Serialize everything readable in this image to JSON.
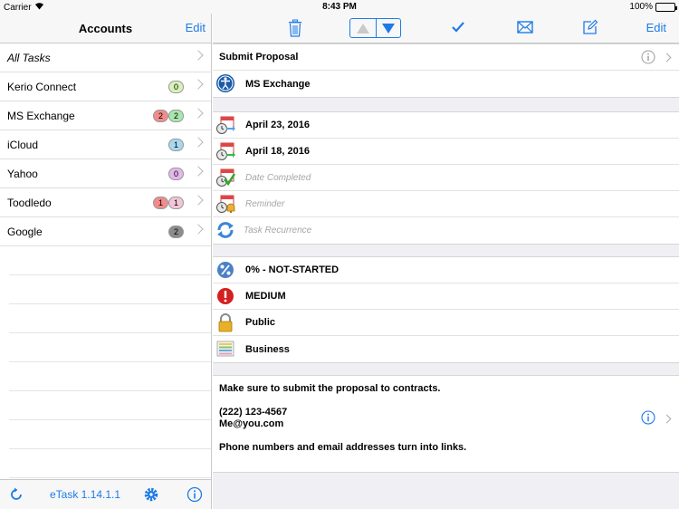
{
  "status_bar": {
    "carrier": "Carrier",
    "time": "8:43 PM",
    "battery": "100%"
  },
  "accounts_panel": {
    "title": "Accounts",
    "edit_label": "Edit",
    "items": [
      {
        "name": "All Tasks",
        "badges": []
      },
      {
        "name": "Kerio Connect",
        "badges": [
          {
            "value": "0",
            "color": "#d9f2b8"
          }
        ]
      },
      {
        "name": "MS Exchange",
        "badges": [
          {
            "value": "2",
            "color": "#f28b8b"
          },
          {
            "value": "2",
            "color": "#a8e6b0"
          }
        ]
      },
      {
        "name": "iCloud",
        "badges": [
          {
            "value": "1",
            "color": "#a8d8f0"
          }
        ]
      },
      {
        "name": "Yahoo",
        "badges": [
          {
            "value": "0",
            "color": "#e3b8ee"
          }
        ]
      },
      {
        "name": "Toodledo",
        "badges": [
          {
            "value": "1",
            "color": "#f28b8b"
          },
          {
            "value": "1",
            "color": "#f2c6d6"
          }
        ]
      },
      {
        "name": "Google",
        "badges": [
          {
            "value": "2",
            "color": "#8c8c8c"
          }
        ]
      }
    ],
    "footer": {
      "version": "eTask 1.14.1.1"
    }
  },
  "task_detail": {
    "edit_label": "Edit",
    "title": "Submit Proposal",
    "account": "MS Exchange",
    "dates": {
      "due": "April 23, 2016",
      "start": "April 18, 2016",
      "completed_placeholder": "Date Completed",
      "reminder_placeholder": "Reminder",
      "recurrence_placeholder": "Task Recurrence"
    },
    "status": "0% - NOT-STARTED",
    "priority": "MEDIUM",
    "sensitivity": "Public",
    "category": "Business",
    "notes": {
      "line1": "Make sure to submit the proposal to contracts.",
      "phone": "(222) 123-4567",
      "email": "Me@you.com",
      "line4": "Phone numbers and email addresses turn into links."
    }
  },
  "colors": {
    "accent": "#1e7be8"
  }
}
